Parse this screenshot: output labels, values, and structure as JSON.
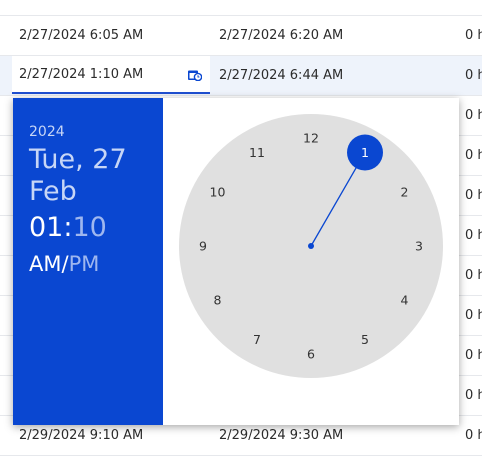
{
  "rows": [
    {
      "start": "",
      "end": "",
      "duration": ""
    },
    {
      "start": "2/27/2024 6:05 AM",
      "end": "2/27/2024 6:20 AM",
      "duration": "0 h"
    },
    {
      "start": "",
      "end": "2/27/2024 6:44 AM",
      "duration": "0 h"
    },
    {
      "start": "",
      "end": "",
      "duration": "0 h"
    },
    {
      "start": "",
      "end": "",
      "duration": "0 h"
    },
    {
      "start": "",
      "end": "",
      "duration": "0 h"
    },
    {
      "start": "",
      "end": "",
      "duration": "0 h"
    },
    {
      "start": "",
      "end": "",
      "duration": "0 h"
    },
    {
      "start": "",
      "end": "",
      "duration": "0 h"
    },
    {
      "start": "",
      "end": "",
      "duration": "0 h"
    },
    {
      "start": "",
      "end": "",
      "duration": "0 h"
    },
    {
      "start": "2/29/2024 9:10 AM",
      "end": "2/29/2024 9:30 AM",
      "duration": "0 h"
    }
  ],
  "editor": {
    "value": "2/27/2024 1:10 AM",
    "icon": "calendar-clock-icon"
  },
  "picker": {
    "year": "2024",
    "date": "Tue, 27 Feb",
    "hour": "01",
    "colon": ":",
    "minute": "10",
    "am": "AM",
    "slash": "/",
    "pm": "PM",
    "clock_numbers": [
      "12",
      "1",
      "2",
      "3",
      "4",
      "5",
      "6",
      "7",
      "8",
      "9",
      "10",
      "11"
    ],
    "selected_hour": 1
  },
  "colors": {
    "accent": "#0a47d1",
    "clock_face": "#e0e0e0"
  }
}
